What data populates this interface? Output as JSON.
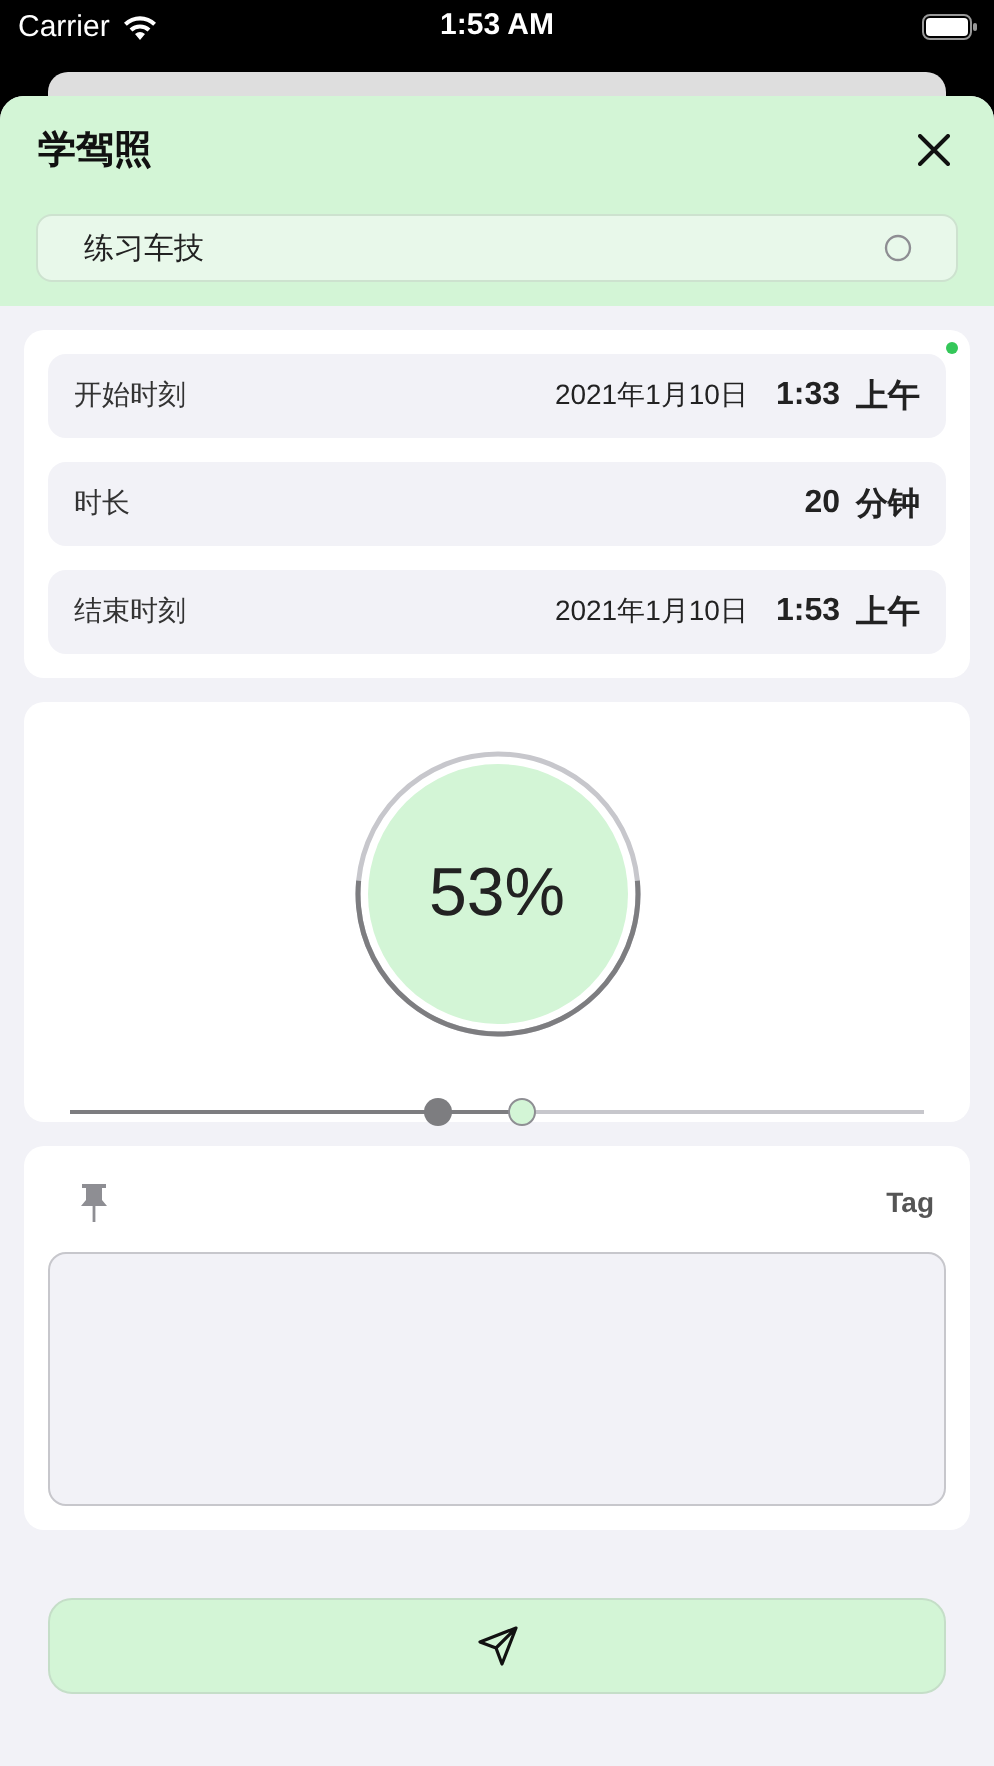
{
  "status_bar": {
    "carrier": "Carrier",
    "time": "1:53 AM"
  },
  "sheet": {
    "title": "学驾照",
    "category": {
      "label": "练习车技",
      "checked": false
    }
  },
  "times": [
    {
      "label": "开始时刻",
      "date": "2021年1月10日",
      "time": "1:33",
      "period": "上午"
    },
    {
      "label": "时长",
      "value": "20",
      "unit": "分钟"
    },
    {
      "label": "结束时刻",
      "date": "2021年1月10日",
      "time": "1:53",
      "period": "上午"
    }
  ],
  "progress": {
    "reading": "53%",
    "level": 0.53
  },
  "range_slider": {
    "start": {
      "level": 0.43
    },
    "end": {
      "level": 0.53
    }
  },
  "note": {
    "tag": "Tag",
    "pinned": false
  }
}
